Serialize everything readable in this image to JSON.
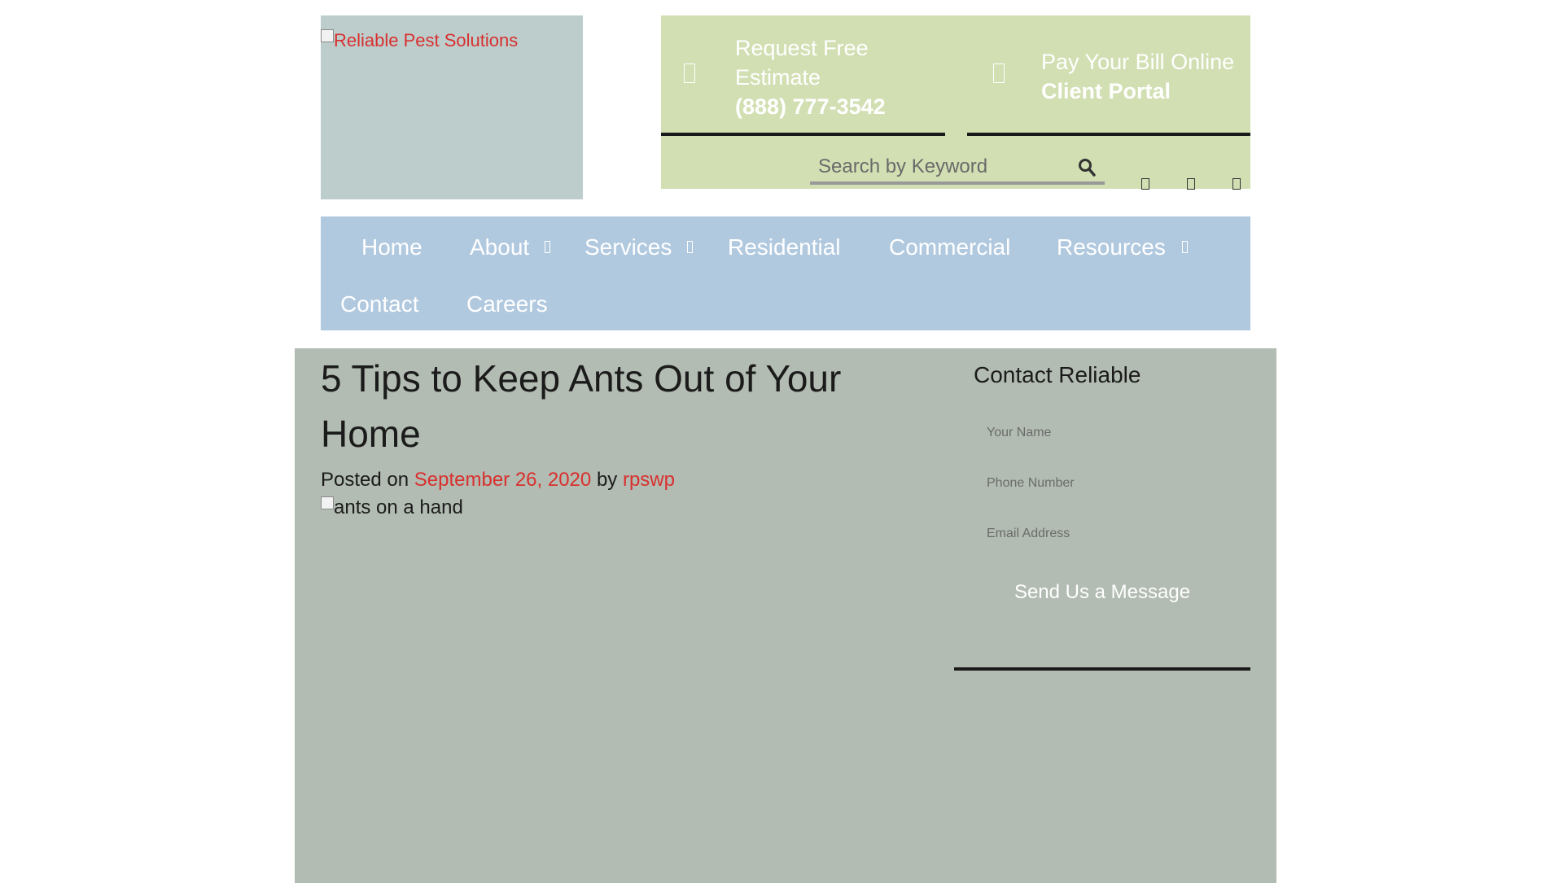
{
  "logo": {
    "alt": "Reliable Pest Solutions"
  },
  "header": {
    "estimate": {
      "line1": "Request Free Estimate",
      "phone": "(888) 777-3542",
      "icon": "phone-icon"
    },
    "portal": {
      "line1": "Pay Your Bill Online",
      "line2": "Client Portal",
      "icon": "credit-card-icon"
    },
    "search": {
      "placeholder": "Search by Keyword",
      "icon": "search-icon"
    },
    "social": [
      "facebook-icon",
      "twitter-icon",
      "instagram-icon"
    ]
  },
  "nav": {
    "items": [
      {
        "label": "Home"
      },
      {
        "label": "About",
        "dropdown": true
      },
      {
        "label": "Services",
        "dropdown": true
      },
      {
        "label": "Residential"
      },
      {
        "label": "Commercial"
      },
      {
        "label": "Resources",
        "dropdown": true
      },
      {
        "label": "Contact"
      },
      {
        "label": "Careers"
      }
    ]
  },
  "post": {
    "title": "5 Tips to Keep Ants Out of Your Home",
    "posted_on": "Posted on",
    "date": "September 26, 2020",
    "by": "by",
    "author": "rpswp",
    "image_alt": "ants on a hand"
  },
  "sidebar": {
    "title": "Contact Reliable",
    "name_placeholder": "Your Name",
    "phone_placeholder": "Phone Number",
    "email_placeholder": "Email Address",
    "submit_label": "Send Us a Message"
  },
  "colors": {
    "accent_red": "#d9302f",
    "header_green": "#d2dfb3",
    "nav_blue": "#b1c9df",
    "content_gray": "#b2bcb2",
    "logo_bg": "#bccdcc"
  }
}
